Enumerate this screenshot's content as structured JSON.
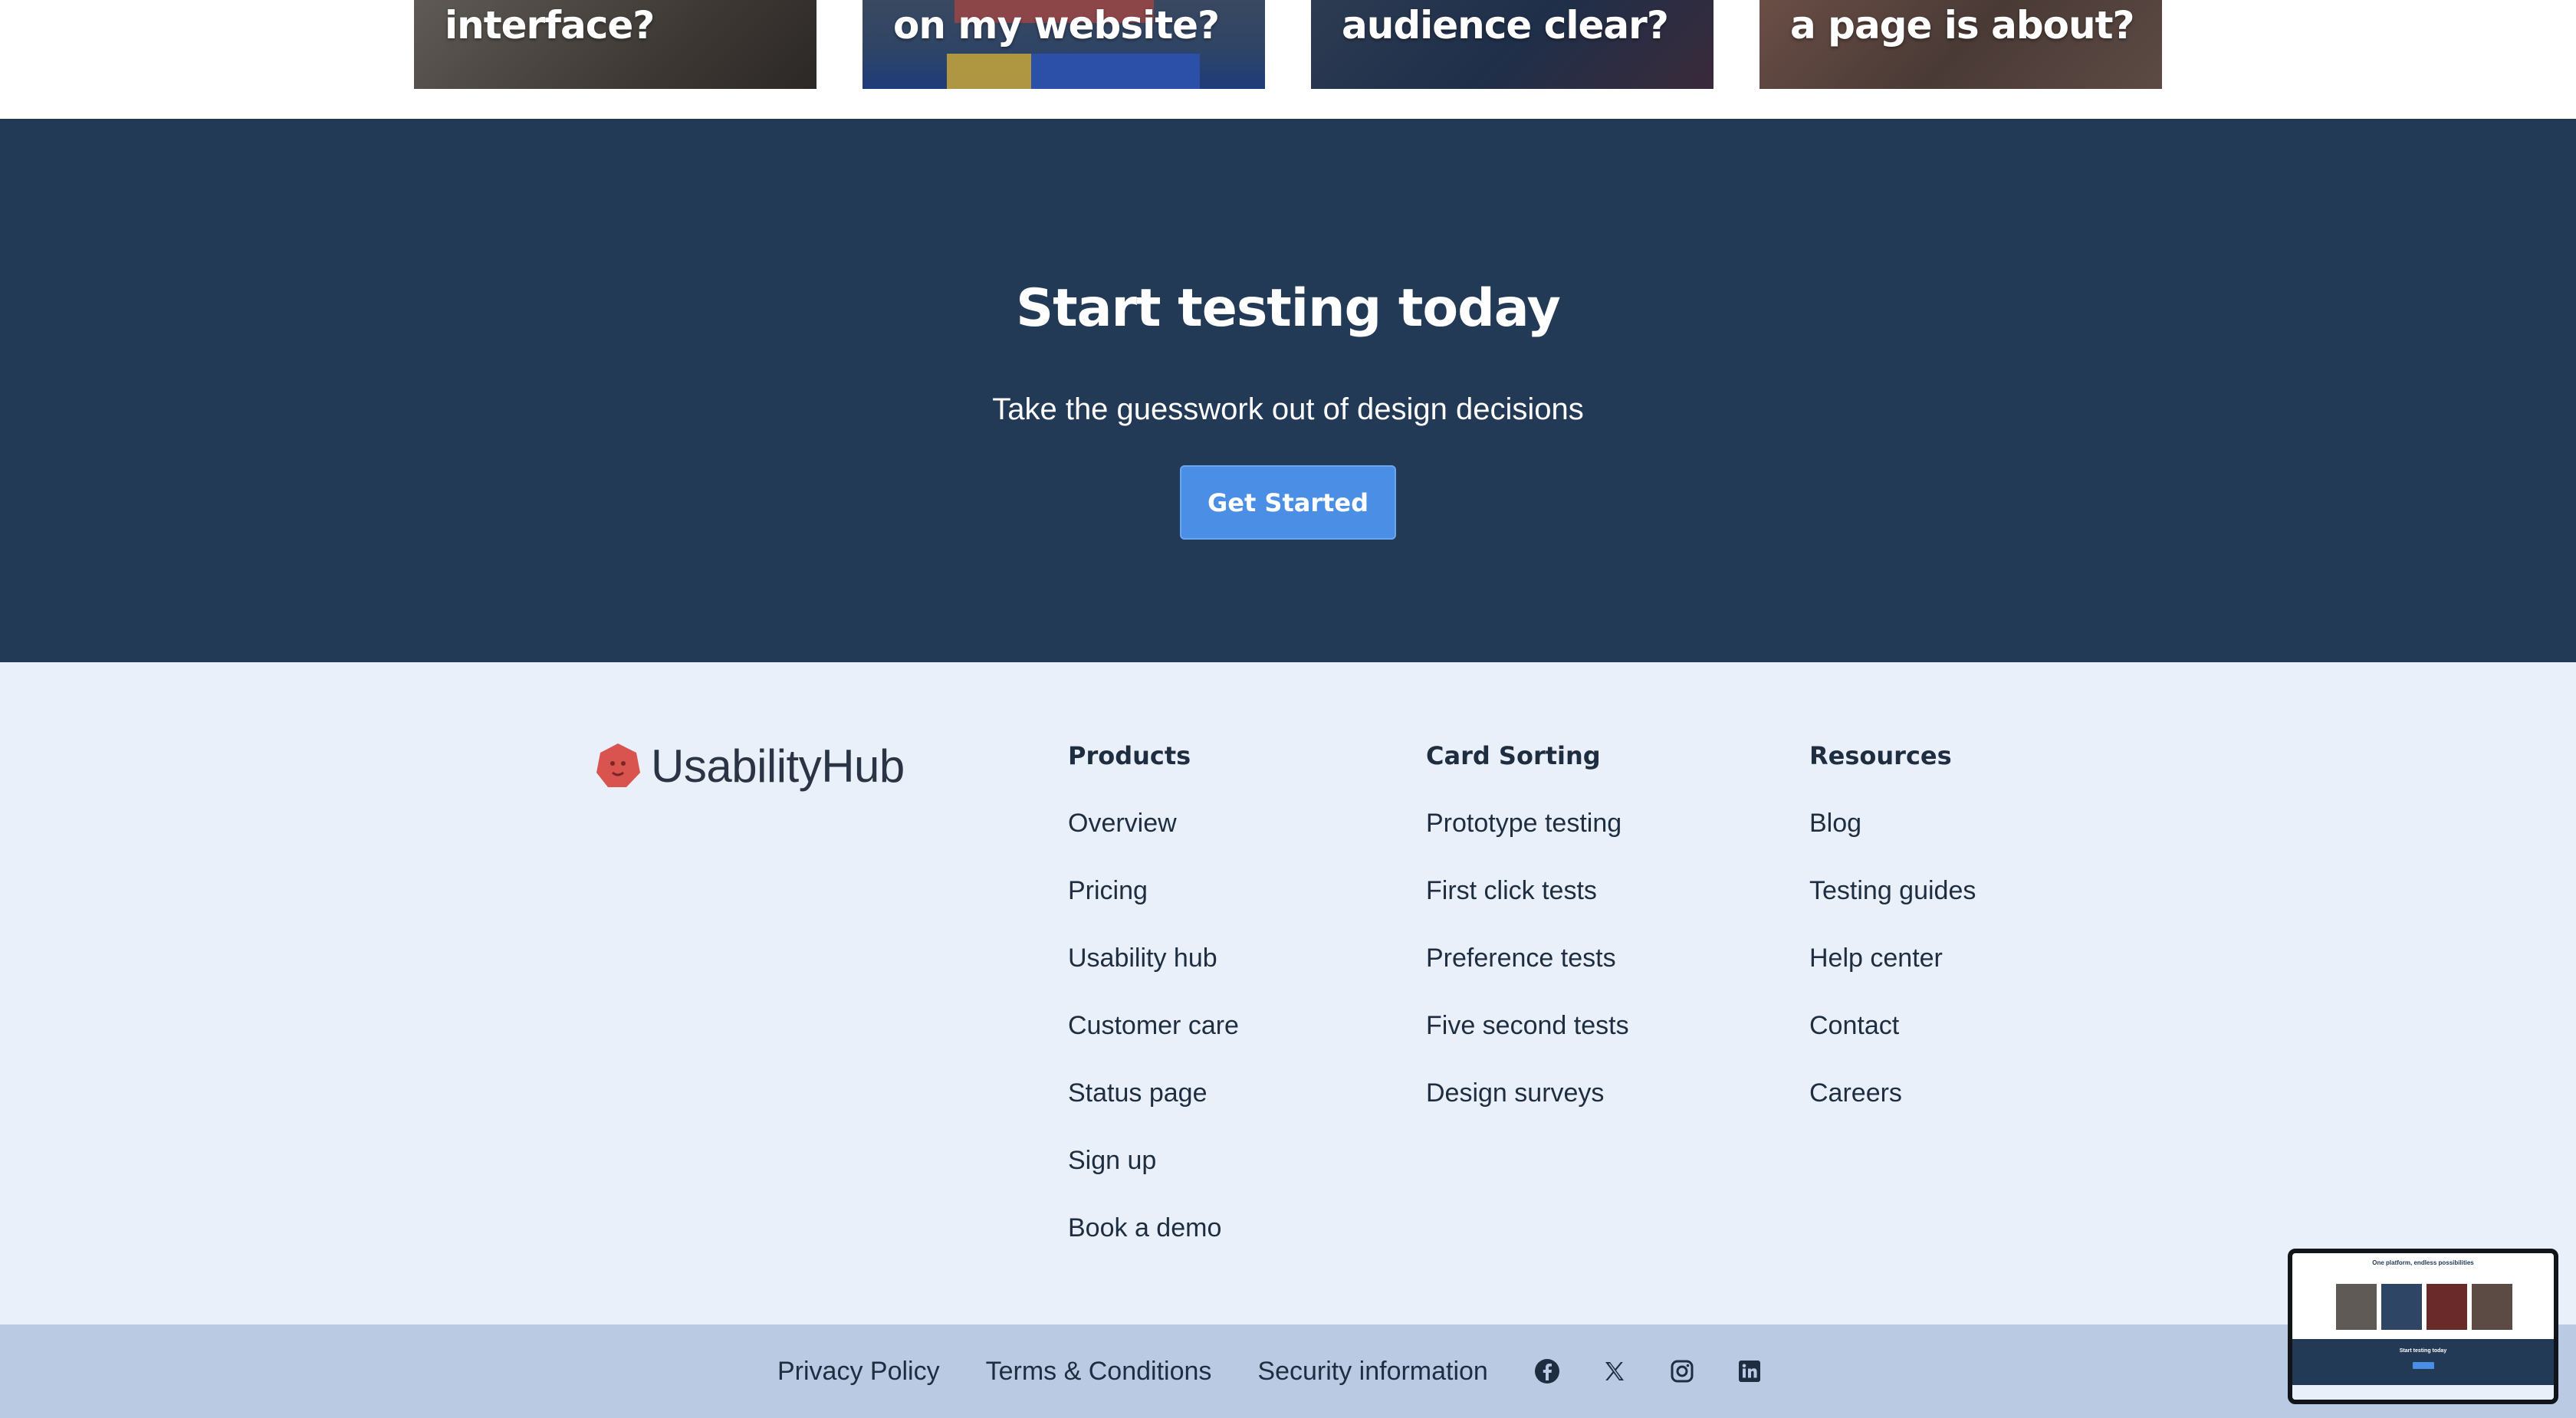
{
  "cards": [
    {
      "title": "interface?"
    },
    {
      "title": "on my website?"
    },
    {
      "title": "audience clear?"
    },
    {
      "title": "a page is about?"
    }
  ],
  "cta": {
    "title": "Start testing today",
    "subtitle": "Take the guesswork out of design decisions",
    "button": "Get Started"
  },
  "footer": {
    "logo": "UsabilityHub",
    "columns": [
      {
        "heading": "Products",
        "links": [
          "Overview",
          "Pricing",
          "Usability hub",
          "Customer care",
          "Status page",
          "Sign up",
          "Book a demo"
        ]
      },
      {
        "heading": "Card Sorting",
        "links": [
          "Prototype testing",
          "First click tests",
          "Preference tests",
          "Five second tests",
          "Design surveys"
        ]
      },
      {
        "heading": "Resources",
        "links": [
          "Blog",
          "Testing guides",
          "Help center",
          "Contact",
          "Careers"
        ]
      }
    ]
  },
  "bottom_bar": {
    "links": [
      "Privacy Policy",
      "Terms & Conditions",
      "Security information"
    ],
    "social_icons": [
      "facebook-icon",
      "x-icon",
      "instagram-icon",
      "linkedin-icon"
    ]
  },
  "preview": {
    "title": "One platform, endless possibilities",
    "cta_title": "Start testing today"
  },
  "colors": {
    "cta_bg": "#233a56",
    "button": "#4a8ee6",
    "footer_bg": "#e9f0f9",
    "bottom_bar_bg": "#b9cae2",
    "logo_mark": "#d9534f"
  }
}
